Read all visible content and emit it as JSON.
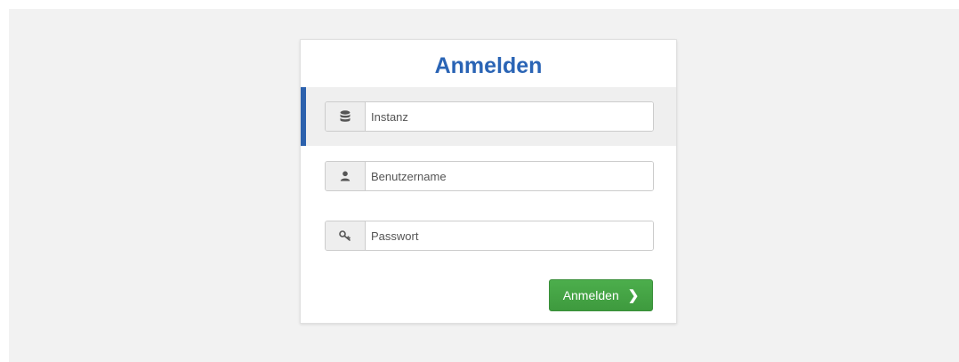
{
  "login": {
    "title": "Anmelden",
    "fields": {
      "instance": {
        "placeholder": "Instanz",
        "value": "",
        "icon": "database-icon"
      },
      "username": {
        "placeholder": "Benutzername",
        "value": "",
        "icon": "user-icon"
      },
      "password": {
        "placeholder": "Passwort",
        "value": "",
        "icon": "key-icon"
      }
    },
    "submit_label": "Anmelden",
    "submit_icon": "chevron-right-icon"
  },
  "colors": {
    "title": "#2a64b5",
    "active_indicator": "#2c61ad",
    "button": "#449d44",
    "backdrop": "#f2f2f2"
  }
}
